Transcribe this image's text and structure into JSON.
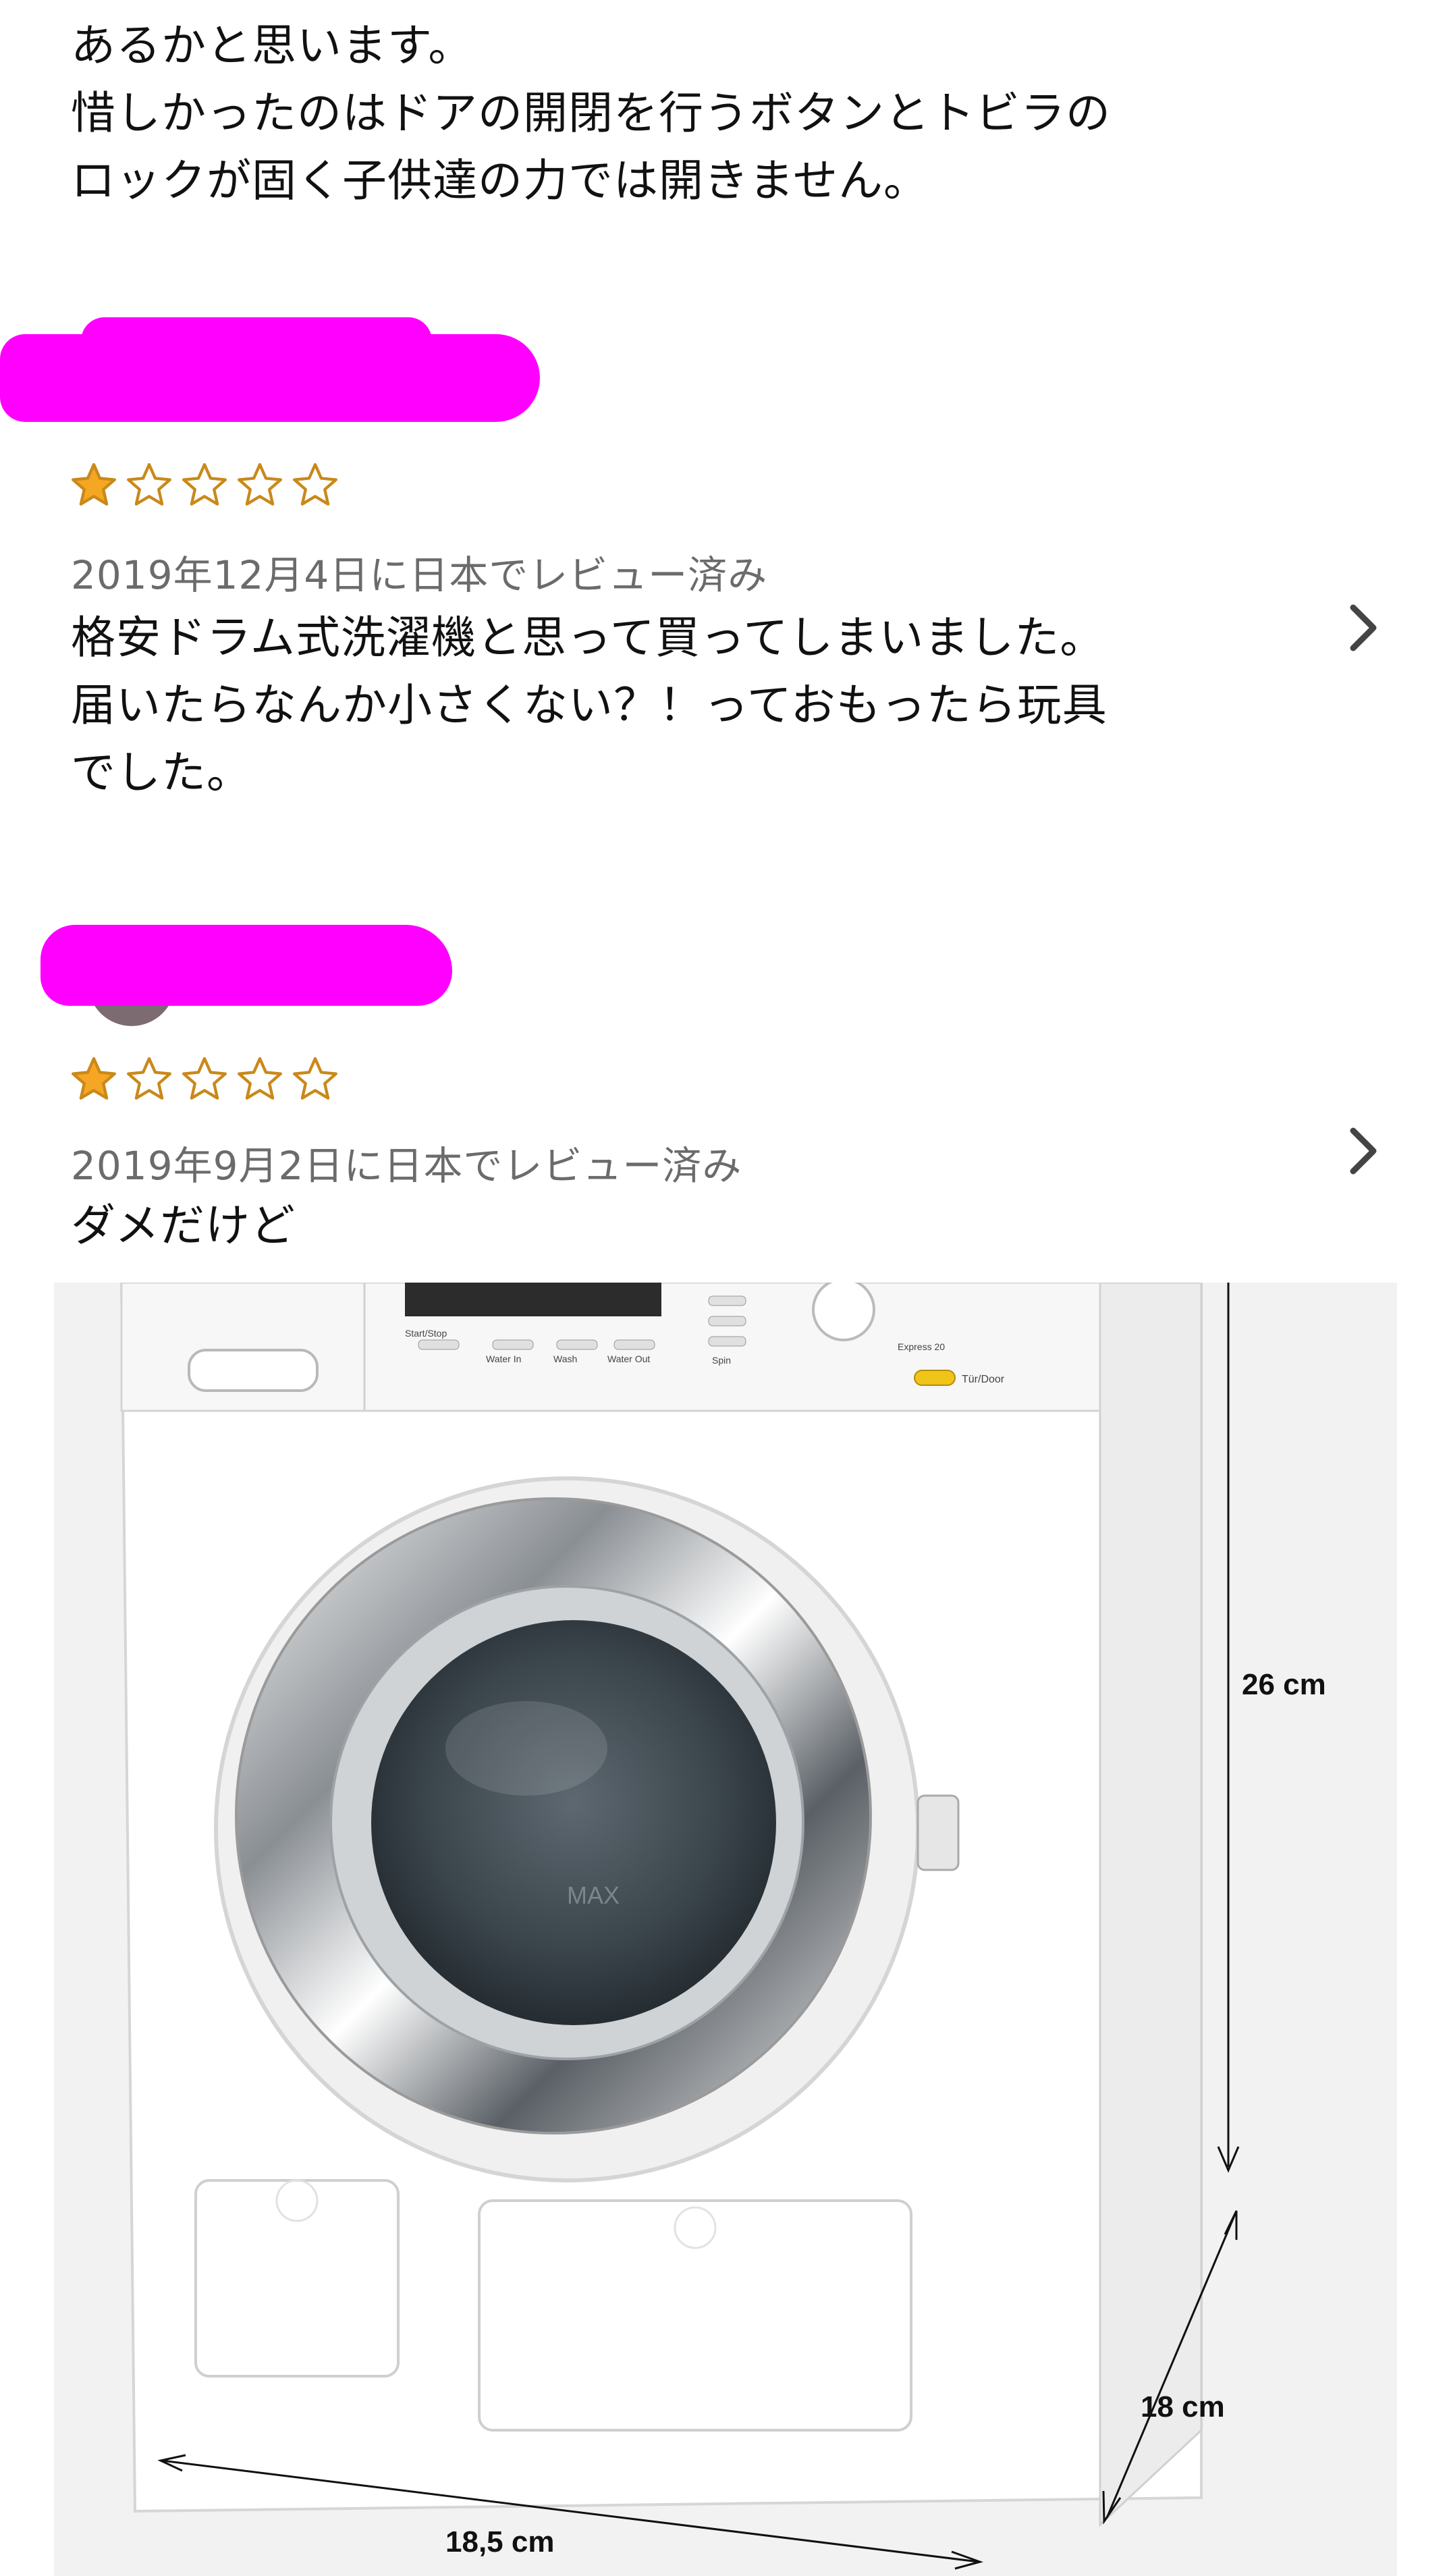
{
  "review_prev": {
    "body_line1": "あるかと思います。",
    "body_line2": "惜しかったのはドアの開閉を行うボタンとトビラの",
    "body_line3": "ロックが固く子供達の力では開きません。"
  },
  "reviews": [
    {
      "rating": 1,
      "rating_max": 5,
      "date": "2019年12月4日に日本でレビュー済み",
      "body_line1": "格安ドラム式洗濯機と思って買ってしまいました。",
      "body_line2": "届いたらなんか小さくない？！っておもったら玩具",
      "body_line3": "でした。"
    },
    {
      "rating": 1,
      "rating_max": 5,
      "date": "2019年9月2日に日本でレビュー済み",
      "body_line1": "ダメだけど"
    }
  ],
  "product_image": {
    "dim_height": "26 cm",
    "dim_depth": "18 cm",
    "dim_width": "18,5 cm",
    "panel_labels": {
      "start": "Start/Stop",
      "water_in": "Water In",
      "wash": "Wash",
      "water_out": "Water Out",
      "spin": "Spin",
      "door": "Tür/Door",
      "express": "Express 20",
      "max": "MAX"
    }
  },
  "colors": {
    "star_fill": "#f5a623",
    "star_outline": "#c9891a",
    "redaction": "#ff00ff",
    "meta_text": "#6b6b6b"
  }
}
